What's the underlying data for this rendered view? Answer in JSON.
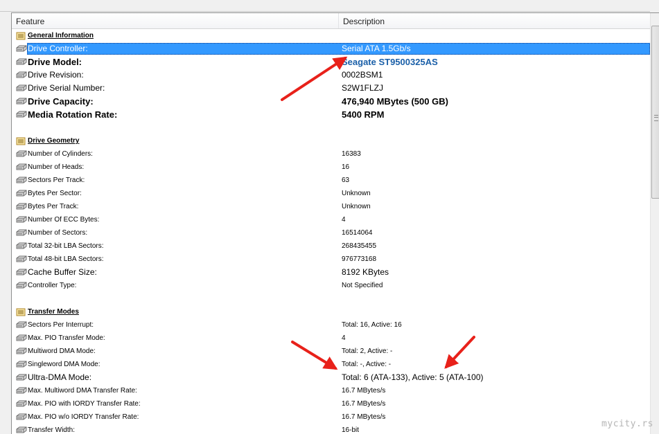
{
  "columns": {
    "feature": "Feature",
    "description": "Description"
  },
  "rows": [
    {
      "kind": "section",
      "icon": "section-icon",
      "feature": "General Information"
    },
    {
      "kind": "item",
      "icon": "drive-icon",
      "feature": "Drive Controller:",
      "value": "Serial ATA 1.5Gb/s",
      "size": "m",
      "selected": true
    },
    {
      "kind": "item",
      "icon": "drive-icon",
      "feature": "Drive Model:",
      "value": "Seagate ST9500325AS",
      "size": "l",
      "bold": true,
      "link": true
    },
    {
      "kind": "item",
      "icon": "drive-icon",
      "feature": "Drive Revision:",
      "value": "0002BSM1",
      "size": "m"
    },
    {
      "kind": "item",
      "icon": "drive-icon",
      "feature": "Drive Serial Number:",
      "value": "S2W1FLZJ",
      "size": "m"
    },
    {
      "kind": "item",
      "icon": "drive-icon",
      "feature": "Drive Capacity:",
      "value": "476,940 MBytes (500 GB)",
      "size": "l",
      "bold": true
    },
    {
      "kind": "item",
      "icon": "drive-icon",
      "feature": "Media Rotation Rate:",
      "value": "5400 RPM",
      "size": "l",
      "bold": true
    },
    {
      "kind": "blank"
    },
    {
      "kind": "section",
      "icon": "section-icon",
      "feature": "Drive Geometry"
    },
    {
      "kind": "item",
      "icon": "drive-icon",
      "feature": "Number of Cylinders:",
      "value": "16383",
      "size": "s"
    },
    {
      "kind": "item",
      "icon": "drive-icon",
      "feature": "Number of Heads:",
      "value": "16",
      "size": "s"
    },
    {
      "kind": "item",
      "icon": "drive-icon",
      "feature": "Sectors Per Track:",
      "value": "63",
      "size": "s"
    },
    {
      "kind": "item",
      "icon": "drive-icon",
      "feature": "Bytes Per Sector:",
      "value": "Unknown",
      "size": "s"
    },
    {
      "kind": "item",
      "icon": "drive-icon",
      "feature": "Bytes Per Track:",
      "value": "Unknown",
      "size": "s"
    },
    {
      "kind": "item",
      "icon": "drive-icon",
      "feature": "Number Of ECC Bytes:",
      "value": "4",
      "size": "s"
    },
    {
      "kind": "item",
      "icon": "drive-icon",
      "feature": "Number of Sectors:",
      "value": "16514064",
      "size": "s"
    },
    {
      "kind": "item",
      "icon": "drive-icon",
      "feature": "Total 32-bit LBA Sectors:",
      "value": "268435455",
      "size": "s"
    },
    {
      "kind": "item",
      "icon": "drive-icon",
      "feature": "Total 48-bit LBA Sectors:",
      "value": "976773168",
      "size": "s"
    },
    {
      "kind": "item",
      "icon": "drive-icon",
      "feature": "Cache Buffer Size:",
      "value": "8192 KBytes",
      "size": "m"
    },
    {
      "kind": "item",
      "icon": "drive-icon",
      "feature": "Controller Type:",
      "value": "Not Specified",
      "size": "s"
    },
    {
      "kind": "blank"
    },
    {
      "kind": "section",
      "icon": "section-icon",
      "feature": "Transfer Modes"
    },
    {
      "kind": "item",
      "icon": "drive-icon",
      "feature": "Sectors Per Interrupt:",
      "value": "Total: 16, Active: 16",
      "size": "s"
    },
    {
      "kind": "item",
      "icon": "drive-icon",
      "feature": "Max. PIO Transfer Mode:",
      "value": "4",
      "size": "s"
    },
    {
      "kind": "item",
      "icon": "drive-icon",
      "feature": "Multiword DMA Mode:",
      "value": "Total: 2, Active: -",
      "size": "s"
    },
    {
      "kind": "item",
      "icon": "drive-icon",
      "feature": "Singleword DMA Mode:",
      "value": "Total: -, Active: -",
      "size": "s"
    },
    {
      "kind": "item",
      "icon": "drive-icon",
      "feature": "Ultra-DMA Mode:",
      "value": "Total: 6 (ATA-133), Active: 5 (ATA-100)",
      "size": "m"
    },
    {
      "kind": "item",
      "icon": "drive-icon",
      "feature": "Max. Multiword DMA Transfer Rate:",
      "value": "16.7 MBytes/s",
      "size": "s"
    },
    {
      "kind": "item",
      "icon": "drive-icon",
      "feature": "Max. PIO with IORDY Transfer Rate:",
      "value": "16.7 MBytes/s",
      "size": "s"
    },
    {
      "kind": "item",
      "icon": "drive-icon",
      "feature": "Max. PIO w/o IORDY Transfer Rate:",
      "value": "16.7 MBytes/s",
      "size": "s"
    },
    {
      "kind": "item",
      "icon": "drive-icon",
      "feature": "Transfer Width:",
      "value": "16-bit",
      "size": "s"
    }
  ],
  "scrollbar": {
    "thumb_icon": "grip-icon"
  },
  "annotations": {
    "arrow_color": "#e8211a"
  },
  "watermark": "mycity.rs"
}
